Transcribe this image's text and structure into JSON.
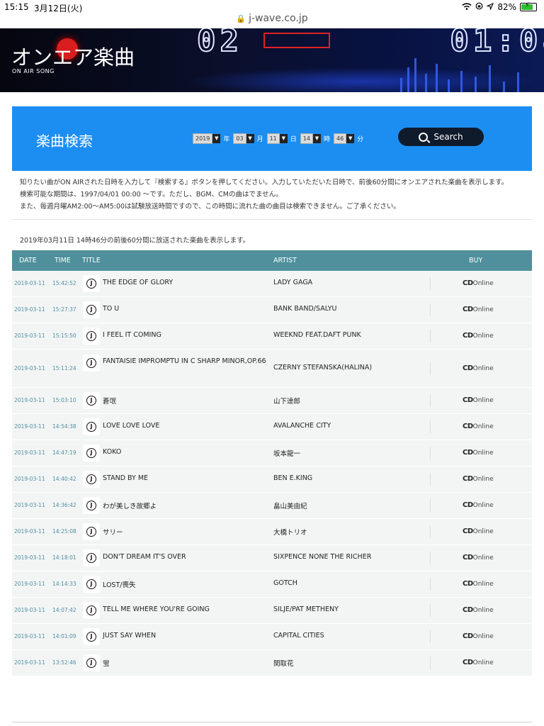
{
  "status": {
    "time": "15:15",
    "date": "3月12日(火)",
    "battery": "82%",
    "battery_level": 0.82
  },
  "browser": {
    "url": "j-wave.co.jp"
  },
  "hero": {
    "title": "オンエア楽曲",
    "subtitle": "ON AIR SONG"
  },
  "search": {
    "title": "楽曲検索",
    "year": "2019",
    "year_unit": "年",
    "month": "03",
    "month_unit": "月",
    "day": "11",
    "day_unit": "日",
    "hour": "14",
    "hour_unit": "時",
    "minute": "46",
    "minute_unit": "分",
    "button": "Search"
  },
  "info": {
    "line1": "知りたい曲がON AIRされた日時を入力して『検索する』ボタンを押してください。入力していただいた日時で、前後60分間にオンエアされた楽曲を表示します。",
    "line2": "検索可能な期間は、1997/04/01 00:00 〜です。ただし、BGM、CMの曲はでません。",
    "line3": "また、毎週月曜AM2:00〜AM5:00は試験放送時間ですので、この時間に流れた曲の曲目は検索できません。ご了承ください。"
  },
  "result_note": "2019年03月11日 14時46分の前後60分間に放送された楽曲を表示します。",
  "table": {
    "headers": {
      "date": "DATE",
      "time": "TIME",
      "title": "TITLE",
      "artist": "ARTIST",
      "buy": "BUY"
    },
    "buy_cd": "CD",
    "buy_online": "Online",
    "rows": [
      {
        "date": "2019-03-11",
        "time": "15:42:52",
        "title": "THE EDGE OF GLORY",
        "artist": "LADY GAGA"
      },
      {
        "date": "2019-03-11",
        "time": "15:27:37",
        "title": "TO U",
        "artist": "BANK BAND/SALYU"
      },
      {
        "date": "2019-03-11",
        "time": "15:15:50",
        "title": "I FEEL IT COMING",
        "artist": "WEEKND FEAT.DAFT PUNK"
      },
      {
        "date": "2019-03-11",
        "time": "15:11:24",
        "title": "FANTAISIE IMPROMPTU IN C SHARP MINOR,OP.66",
        "artist": "CZERNY STEFANSKA(HALINA)"
      },
      {
        "date": "2019-03-11",
        "time": "15:03:10",
        "title": "蒼氓",
        "artist": "山下達郎"
      },
      {
        "date": "2019-03-11",
        "time": "14:54:38",
        "title": "LOVE LOVE LOVE",
        "artist": "AVALANCHE CITY"
      },
      {
        "date": "2019-03-11",
        "time": "14:47:19",
        "title": "KOKO",
        "artist": "坂本龍一"
      },
      {
        "date": "2019-03-11",
        "time": "14:40:42",
        "title": "STAND BY ME",
        "artist": "BEN E.KING"
      },
      {
        "date": "2019-03-11",
        "time": "14:36:42",
        "title": "わが美しき故郷よ",
        "artist": "畠山美由紀"
      },
      {
        "date": "2019-03-11",
        "time": "14:25:08",
        "title": "サリー",
        "artist": "大橋トリオ"
      },
      {
        "date": "2019-03-11",
        "time": "14:18:01",
        "title": "DON'T DREAM IT'S OVER",
        "artist": "SIXPENCE NONE THE RICHER"
      },
      {
        "date": "2019-03-11",
        "time": "14:14:33",
        "title": "LOST/喪失",
        "artist": "GOTCH"
      },
      {
        "date": "2019-03-11",
        "time": "14:07:42",
        "title": "TELL ME WHERE YOU'RE GOING",
        "artist": "SILJE/PAT METHENY"
      },
      {
        "date": "2019-03-11",
        "time": "14:01:09",
        "title": "JUST SAY WHEN",
        "artist": "CAPITAL CITIES"
      },
      {
        "date": "2019-03-11",
        "time": "13:52:46",
        "title": "蛍",
        "artist": "関取花"
      }
    ]
  }
}
